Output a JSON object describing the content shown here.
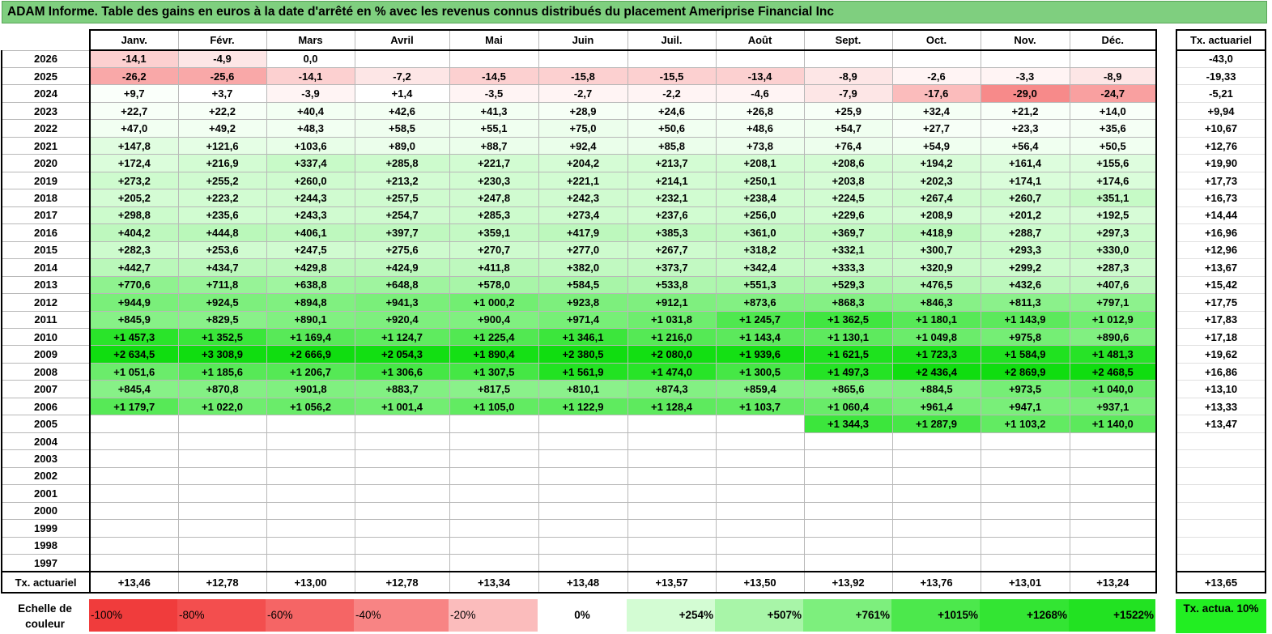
{
  "title": "ADAM Informe. Table des gains en euros à la date d'arrêté en % avec les revenus connus distribués du placement Ameriprise Financial Inc",
  "months": [
    "Janv.",
    "Févr.",
    "Mars",
    "Avril",
    "Mai",
    "Juin",
    "Juil.",
    "Août",
    "Sept.",
    "Oct.",
    "Nov.",
    "Déc."
  ],
  "side_header": "Tx. actuariel",
  "rows": [
    {
      "year": "2026",
      "values": [
        "-14,1",
        "-4,9",
        "0,0",
        "",
        "",
        "",
        "",
        "",
        "",
        "",
        "",
        ""
      ],
      "colors": [
        "#fcd0d0",
        "#fde6e6",
        "#ffffff",
        "",
        "",
        "",
        "",
        "",
        "",
        "",
        "",
        ""
      ],
      "rate": "-43,0"
    },
    {
      "year": "2025",
      "values": [
        "-26,2",
        "-25,6",
        "-14,1",
        "-7,2",
        "-14,5",
        "-15,8",
        "-15,5",
        "-13,4",
        "-8,9",
        "-2,6",
        "-3,3",
        "-8,9"
      ],
      "colors": [
        "#f9a8a8",
        "#f9a8a8",
        "#fcd0d0",
        "#fde6e6",
        "#fcd0d0",
        "#fcd0d0",
        "#fcd0d0",
        "#fcd0d0",
        "#fde6e6",
        "#fff4f4",
        "#fff4f4",
        "#fde6e6"
      ],
      "rate": "-19,33"
    },
    {
      "year": "2024",
      "values": [
        "+9,7",
        "+3,7",
        "-3,9",
        "+1,4",
        "-3,5",
        "-2,7",
        "-2,2",
        "-4,6",
        "-7,9",
        "-17,6",
        "-29,0",
        "-24,7"
      ],
      "colors": [
        "#fafffa",
        "#ffffff",
        "#fff4f4",
        "#ffffff",
        "#fff4f4",
        "#fff4f4",
        "#fff4f4",
        "#fff4f4",
        "#fde6e6",
        "#fbbcbc",
        "#f78a8a",
        "#f9a0a0"
      ],
      "rate": "-5,21"
    },
    {
      "year": "2023",
      "values": [
        "+22,7",
        "+22,2",
        "+40,4",
        "+42,6",
        "+41,3",
        "+28,9",
        "+24,6",
        "+26,8",
        "+25,9",
        "+32,4",
        "+21,2",
        "+14,0"
      ],
      "colors": [
        "#f7fff7",
        "#f7fff7",
        "#f3fff3",
        "#f3fff3",
        "#f3fff3",
        "#f6fff6",
        "#f7fff7",
        "#f7fff7",
        "#f7fff7",
        "#f5fff5",
        "#f8fff8",
        "#f9fff9"
      ],
      "rate": "+9,94"
    },
    {
      "year": "2022",
      "values": [
        "+47,0",
        "+49,2",
        "+48,3",
        "+58,5",
        "+55,1",
        "+75,0",
        "+50,6",
        "+48,6",
        "+54,7",
        "+27,7",
        "+23,3",
        "+35,6"
      ],
      "colors": [
        "#f2fff2",
        "#f2fff2",
        "#f2fff2",
        "#effeef",
        "#f0fff0",
        "#ecfeec",
        "#f1fff1",
        "#f2fff2",
        "#f0fff0",
        "#f7fff7",
        "#f8fff8",
        "#f5fff5"
      ],
      "rate": "+10,67"
    },
    {
      "year": "2021",
      "values": [
        "+147,8",
        "+121,6",
        "+103,6",
        "+89,0",
        "+88,7",
        "+92,4",
        "+85,8",
        "+73,8",
        "+76,4",
        "+54,9",
        "+56,4",
        "+50,5"
      ],
      "colors": [
        "#e0fde0",
        "#e5fee5",
        "#e8fee8",
        "#ebfeeb",
        "#ebfeeb",
        "#eafeea",
        "#ebfeeb",
        "#edfeed",
        "#edfeed",
        "#f0fff0",
        "#f0fff0",
        "#f1fff1"
      ],
      "rate": "+12,76"
    },
    {
      "year": "2020",
      "values": [
        "+172,4",
        "+216,9",
        "+337,4",
        "+285,8",
        "+221,7",
        "+204,2",
        "+213,7",
        "+208,1",
        "+208,6",
        "+194,2",
        "+161,4",
        "+155,6"
      ],
      "colors": [
        "#dbfddb",
        "#d3fcd3",
        "#c8fac8",
        "#cdfbcd",
        "#d2fcd2",
        "#d5fcd5",
        "#d3fcd3",
        "#d4fcd4",
        "#d4fcd4",
        "#d7fcd7",
        "#ddfddd",
        "#defdde"
      ],
      "rate": "+19,90"
    },
    {
      "year": "2019",
      "values": [
        "+273,2",
        "+255,2",
        "+260,0",
        "+213,2",
        "+230,3",
        "+221,1",
        "+214,1",
        "+250,1",
        "+203,8",
        "+202,3",
        "+174,1",
        "+174,6"
      ],
      "colors": [
        "#cefbce",
        "#d0fbd0",
        "#cffbcf",
        "#d3fcd3",
        "#d1fcd1",
        "#d2fcd2",
        "#d3fcd3",
        "#d0fbd0",
        "#d5fcd5",
        "#d5fcd5",
        "#dafdda",
        "#dafdda"
      ],
      "rate": "+17,73"
    },
    {
      "year": "2018",
      "values": [
        "+205,2",
        "+223,2",
        "+244,3",
        "+257,5",
        "+247,8",
        "+242,3",
        "+232,1",
        "+238,4",
        "+224,5",
        "+267,4",
        "+260,7",
        "+351,1"
      ],
      "colors": [
        "#d4fcd4",
        "#d2fcd2",
        "#d0fbd0",
        "#cffbcf",
        "#d0fbd0",
        "#d0fbd0",
        "#d1fcd1",
        "#d1fcd1",
        "#d2fcd2",
        "#cefbce",
        "#cffbcf",
        "#c6fac6"
      ],
      "rate": "+16,73"
    },
    {
      "year": "2017",
      "values": [
        "+298,8",
        "+235,6",
        "+243,3",
        "+254,7",
        "+285,3",
        "+273,4",
        "+237,6",
        "+256,0",
        "+229,6",
        "+208,9",
        "+201,2",
        "+192,5"
      ],
      "colors": [
        "#ccfbcc",
        "#d1fcd1",
        "#d0fbd0",
        "#cffbcf",
        "#cdfbcd",
        "#cefbce",
        "#d1fcd1",
        "#cffbcf",
        "#d1fcd1",
        "#d4fcd4",
        "#d5fcd5",
        "#d7fcd7"
      ],
      "rate": "+14,44"
    },
    {
      "year": "2016",
      "values": [
        "+404,2",
        "+444,8",
        "+406,1",
        "+397,7",
        "+359,1",
        "+417,9",
        "+385,3",
        "+361,0",
        "+369,7",
        "+418,9",
        "+288,7",
        "+297,3"
      ],
      "colors": [
        "#bef8be",
        "#baf8ba",
        "#bef8be",
        "#bff8bf",
        "#c4f9c4",
        "#bdf8bd",
        "#c1f9c1",
        "#c4f9c4",
        "#c3f9c3",
        "#bdf8bd",
        "#cdfbcd",
        "#ccfbcc"
      ],
      "rate": "+16,96"
    },
    {
      "year": "2015",
      "values": [
        "+282,3",
        "+253,6",
        "+247,5",
        "+275,6",
        "+270,7",
        "+277,0",
        "+267,7",
        "+318,2",
        "+332,1",
        "+300,7",
        "+293,3",
        "+330,0"
      ],
      "colors": [
        "#cdfbcd",
        "#d0fbd0",
        "#d0fbd0",
        "#cefbce",
        "#cefbce",
        "#cdfbcd",
        "#cefbce",
        "#c9fac9",
        "#c8fac8",
        "#cbfbcb",
        "#ccfbcc",
        "#c8fac8"
      ],
      "rate": "+12,96"
    },
    {
      "year": "2014",
      "values": [
        "+442,7",
        "+434,7",
        "+429,8",
        "+424,9",
        "+411,8",
        "+382,0",
        "+373,7",
        "+342,4",
        "+333,3",
        "+320,9",
        "+299,2",
        "+287,3"
      ],
      "colors": [
        "#baf8ba",
        "#bbf8bb",
        "#bcf8bc",
        "#bcf8bc",
        "#bef8be",
        "#c1f9c1",
        "#c2f9c2",
        "#c6fac6",
        "#c7fac7",
        "#c9fac9",
        "#ccfbcc",
        "#cdfbcd"
      ],
      "rate": "+13,67"
    },
    {
      "year": "2013",
      "values": [
        "+770,6",
        "+711,8",
        "+638,8",
        "+648,8",
        "+578,0",
        "+584,5",
        "+533,8",
        "+551,3",
        "+529,3",
        "+476,5",
        "+432,6",
        "+407,6"
      ],
      "colors": [
        "#8ff28f",
        "#97f397",
        "#a0f5a0",
        "#9ff49f",
        "#a8f5a8",
        "#a8f5a8",
        "#aef6ae",
        "#acf6ac",
        "#aef6ae",
        "#b5f7b5",
        "#bbf8bb",
        "#bef8be"
      ],
      "rate": "+15,42"
    },
    {
      "year": "2012",
      "values": [
        "+944,9",
        "+924,5",
        "+894,8",
        "+941,3",
        "+1 000,2",
        "+923,8",
        "+912,1",
        "+873,6",
        "+868,3",
        "+846,3",
        "+811,3",
        "+797,1"
      ],
      "colors": [
        "#7aef7a",
        "#7def7d",
        "#80f080",
        "#7aef7a",
        "#72ee72",
        "#7def7d",
        "#7fef7f",
        "#83f083",
        "#84f084",
        "#87f187",
        "#8bf18b",
        "#8df28d"
      ],
      "rate": "+17,75"
    },
    {
      "year": "2011",
      "values": [
        "+845,9",
        "+829,5",
        "+890,1",
        "+920,4",
        "+900,4",
        "+971,4",
        "+1 031,8",
        "+1 245,7",
        "+1 362,5",
        "+1 180,1",
        "+1 143,9",
        "+1 012,9"
      ],
      "colors": [
        "#87f187",
        "#89f189",
        "#81f081",
        "#7eef7e",
        "#80f080",
        "#77ef77",
        "#6eed6e",
        "#4fe84f",
        "#40e640",
        "#57e957",
        "#5ce95c",
        "#71ee71"
      ],
      "rate": "+17,83"
    },
    {
      "year": "2010",
      "values": [
        "+1 457,3",
        "+1 352,5",
        "+1 169,4",
        "+1 124,7",
        "+1 225,4",
        "+1 346,1",
        "+1 216,0",
        "+1 143,4",
        "+1 130,1",
        "+1 049,8",
        "+975,8",
        "+890,6"
      ],
      "colors": [
        "#2ae42a",
        "#3ae63a",
        "#58e958",
        "#5feb5f",
        "#52e852",
        "#3ce63c",
        "#55e955",
        "#5ce95c",
        "#5eea5e",
        "#6bec6b",
        "#75ee75",
        "#81f081"
      ],
      "rate": "+17,18"
    },
    {
      "year": "2009",
      "values": [
        "+2 634,5",
        "+3 308,9",
        "+2 666,9",
        "+2 054,3",
        "+1 890,4",
        "+2 380,5",
        "+2 080,0",
        "+1 939,6",
        "+1 621,5",
        "+1 723,3",
        "+1 584,9",
        "+1 481,3"
      ],
      "colors": [
        "#10dd10",
        "#10dd10",
        "#10dd10",
        "#12df12",
        "#15e015",
        "#10dd10",
        "#12df12",
        "#14e014",
        "#1ee21e",
        "#1ae11a",
        "#20e220",
        "#27e327"
      ],
      "rate": "+19,62"
    },
    {
      "year": "2008",
      "values": [
        "+1 051,6",
        "+1 185,6",
        "+1 206,7",
        "+1 306,6",
        "+1 307,5",
        "+1 561,9",
        "+1 474,0",
        "+1 300,5",
        "+1 497,3",
        "+2 436,4",
        "+2 869,9",
        "+2 468,5"
      ],
      "colors": [
        "#6bec6b",
        "#57e957",
        "#55e955",
        "#45e745",
        "#45e745",
        "#22e222",
        "#28e428",
        "#46e746",
        "#25e325",
        "#10dd10",
        "#10dd10",
        "#10dd10"
      ],
      "rate": "+16,86"
    },
    {
      "year": "2007",
      "values": [
        "+845,4",
        "+870,8",
        "+901,8",
        "+883,7",
        "+817,5",
        "+810,1",
        "+874,3",
        "+859,4",
        "+865,6",
        "+884,5",
        "+973,5",
        "+1 040,0"
      ],
      "colors": [
        "#87f187",
        "#84f084",
        "#80f080",
        "#82f082",
        "#8af18a",
        "#8bf18b",
        "#83f083",
        "#86f186",
        "#85f185",
        "#82f082",
        "#76ee76",
        "#6dec6d"
      ],
      "rate": "+13,10"
    },
    {
      "year": "2006",
      "values": [
        "+1 179,7",
        "+1 022,0",
        "+1 056,2",
        "+1 001,4",
        "+1 105,0",
        "+1 122,9",
        "+1 128,4",
        "+1 103,7",
        "+1 060,4",
        "+961,4",
        "+947,1",
        "+937,1"
      ],
      "colors": [
        "#57e957",
        "#6fed6f",
        "#6aec6a",
        "#72ee72",
        "#62eb62",
        "#5feb5f",
        "#5eea5e",
        "#62eb62",
        "#69ec69",
        "#77ef77",
        "#79ef79",
        "#7aef7a"
      ],
      "rate": "+13,33"
    },
    {
      "year": "2005",
      "values": [
        "",
        "",
        "",
        "",
        "",
        "",
        "",
        "",
        "+1 344,3",
        "+1 287,9",
        "+1 103,2",
        "+1 140,0"
      ],
      "colors": [
        "",
        "",
        "",
        "",
        "",
        "",
        "",
        "",
        "#3ce63c",
        "#47e747",
        "#62eb62",
        "#5ce95c"
      ],
      "rate": "+13,47"
    },
    {
      "year": "2004",
      "values": [
        "",
        "",
        "",
        "",
        "",
        "",
        "",
        "",
        "",
        "",
        "",
        ""
      ],
      "colors": [],
      "rate": ""
    },
    {
      "year": "2003",
      "values": [
        "",
        "",
        "",
        "",
        "",
        "",
        "",
        "",
        "",
        "",
        "",
        ""
      ],
      "colors": [],
      "rate": ""
    },
    {
      "year": "2002",
      "values": [
        "",
        "",
        "",
        "",
        "",
        "",
        "",
        "",
        "",
        "",
        "",
        ""
      ],
      "colors": [],
      "rate": ""
    },
    {
      "year": "2001",
      "values": [
        "",
        "",
        "",
        "",
        "",
        "",
        "",
        "",
        "",
        "",
        "",
        ""
      ],
      "colors": [],
      "rate": ""
    },
    {
      "year": "2000",
      "values": [
        "",
        "",
        "",
        "",
        "",
        "",
        "",
        "",
        "",
        "",
        "",
        ""
      ],
      "colors": [],
      "rate": ""
    },
    {
      "year": "1999",
      "values": [
        "",
        "",
        "",
        "",
        "",
        "",
        "",
        "",
        "",
        "",
        "",
        ""
      ],
      "colors": [],
      "rate": ""
    },
    {
      "year": "1998",
      "values": [
        "",
        "",
        "",
        "",
        "",
        "",
        "",
        "",
        "",
        "",
        "",
        ""
      ],
      "colors": [],
      "rate": ""
    },
    {
      "year": "1997",
      "values": [
        "",
        "",
        "",
        "",
        "",
        "",
        "",
        "",
        "",
        "",
        "",
        ""
      ],
      "colors": [],
      "rate": ""
    }
  ],
  "totals": {
    "label": "Tx. actuariel",
    "values": [
      "+13,46",
      "+12,78",
      "+13,00",
      "+12,78",
      "+13,34",
      "+13,48",
      "+13,57",
      "+13,50",
      "+13,92",
      "+13,76",
      "+13,01",
      "+13,24"
    ],
    "overall": "+13,65"
  },
  "scale": {
    "label": "Echelle de couleur",
    "items": [
      {
        "label": "-100%",
        "color": "#f03c3c",
        "kind": "neg"
      },
      {
        "label": "-80%",
        "color": "#f34e4e",
        "kind": "neg"
      },
      {
        "label": "-60%",
        "color": "#f56565",
        "kind": "neg"
      },
      {
        "label": "-40%",
        "color": "#f88484",
        "kind": "neg"
      },
      {
        "label": "-20%",
        "color": "#fbbcbc",
        "kind": "neg"
      },
      {
        "label": "0%",
        "color": "#ffffff",
        "kind": "zero"
      },
      {
        "label": "+254%",
        "color": "#d3fcd3",
        "kind": "pos"
      },
      {
        "label": "+507%",
        "color": "#a8f5a8",
        "kind": "pos"
      },
      {
        "label": "+761%",
        "color": "#7def7d",
        "kind": "pos"
      },
      {
        "label": "+1015%",
        "color": "#4ce84c",
        "kind": "pos"
      },
      {
        "label": "+1268%",
        "color": "#33e533",
        "kind": "pos"
      },
      {
        "label": "+1522%",
        "color": "#22e222",
        "kind": "pos"
      }
    ],
    "legend": "Tx. actua. 10%",
    "legend_color": "#22ee22"
  }
}
